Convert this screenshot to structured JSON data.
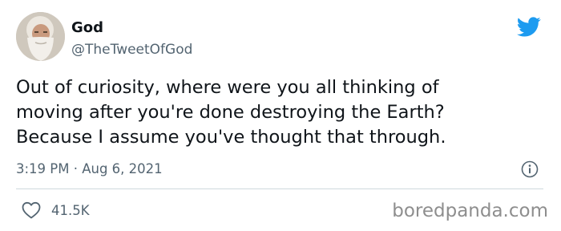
{
  "author": {
    "display_name": "God",
    "handle": "@TheTweetOfGod"
  },
  "tweet": {
    "lines": [
      "Out of curiosity, where were you all thinking of",
      "moving after you're done destroying the Earth?",
      "Because I assume you've thought that through."
    ],
    "timestamp": "3:19 PM · Aug 6, 2021"
  },
  "engagement": {
    "likes": "41.5K"
  },
  "watermark": "boredpanda.com",
  "icons": {
    "logo": "twitter-bird-icon",
    "info": "info-icon",
    "like": "heart-icon"
  },
  "colors": {
    "twitter_blue": "#1d9bf0",
    "text": "#0f1419",
    "secondary_text": "#536471",
    "divider": "#cfd9de",
    "watermark": "#8e8e8e"
  }
}
